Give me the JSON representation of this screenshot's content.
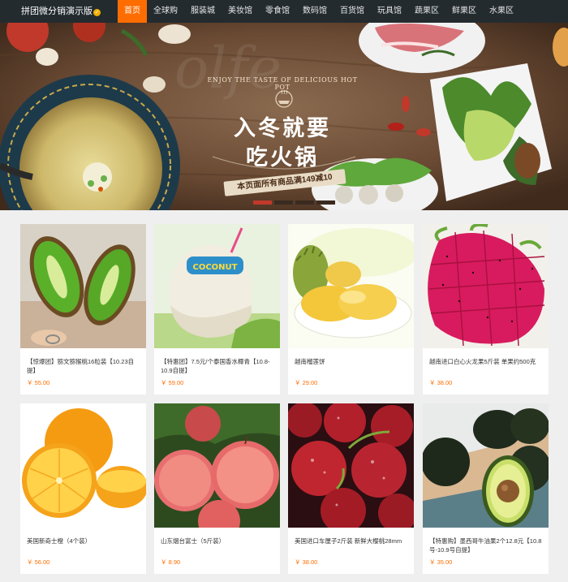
{
  "header": {
    "brand": "拼团微分销演示版",
    "nav": [
      {
        "label": "首页",
        "active": true
      },
      {
        "label": "全球购"
      },
      {
        "label": "服装城"
      },
      {
        "label": "美妆馆"
      },
      {
        "label": "零食馆"
      },
      {
        "label": "数码馆"
      },
      {
        "label": "百货馆"
      },
      {
        "label": "玩具馆"
      },
      {
        "label": "蔬果区"
      },
      {
        "label": "鲜果区"
      },
      {
        "label": "水果区"
      }
    ]
  },
  "banner": {
    "english": "ENJOY THE TASTE OF DELICIOUS HOT POT",
    "line1": "入冬就要",
    "line2": "吃火锅",
    "ribbon": "本页面所有商品满149减10",
    "slides": 4,
    "active_slide": 0
  },
  "products": [
    {
      "title": "【惊爆团】猕文猕猴桃16粒装【10.23自提】",
      "price": "￥ 55.00",
      "image": "kiwi"
    },
    {
      "title": "【特惠团】7.5元/个泰国香水椰青【10.8-10.9自提】",
      "price": "￥ 59.00",
      "image": "coconut"
    },
    {
      "title": "越南榴莲饼",
      "price": "￥ 29.00",
      "image": "durian"
    },
    {
      "title": "越南进口白心火龙果5斤装 单果约500克",
      "price": "￥ 38.00",
      "image": "dragonfruit"
    },
    {
      "title": "美国新奇士橙（4个装）",
      "price": "￥ 56.00",
      "image": "orange"
    },
    {
      "title": "山东烟台富士（5斤装）",
      "price": "￥ 8.90",
      "image": "apple"
    },
    {
      "title": "美国进口车厘子2斤装 新鲜大樱桃28mm",
      "price": "￥ 38.00",
      "image": "cherry"
    },
    {
      "title": "【特惠购】墨西哥牛油果2个12.8元【10.8号-10.9号自提】",
      "price": "￥ 35.00",
      "image": "avocado"
    }
  ],
  "colors": {
    "nav_bg": "#232b2f",
    "accent": "#ff6d00",
    "page_bg": "#efefef"
  }
}
